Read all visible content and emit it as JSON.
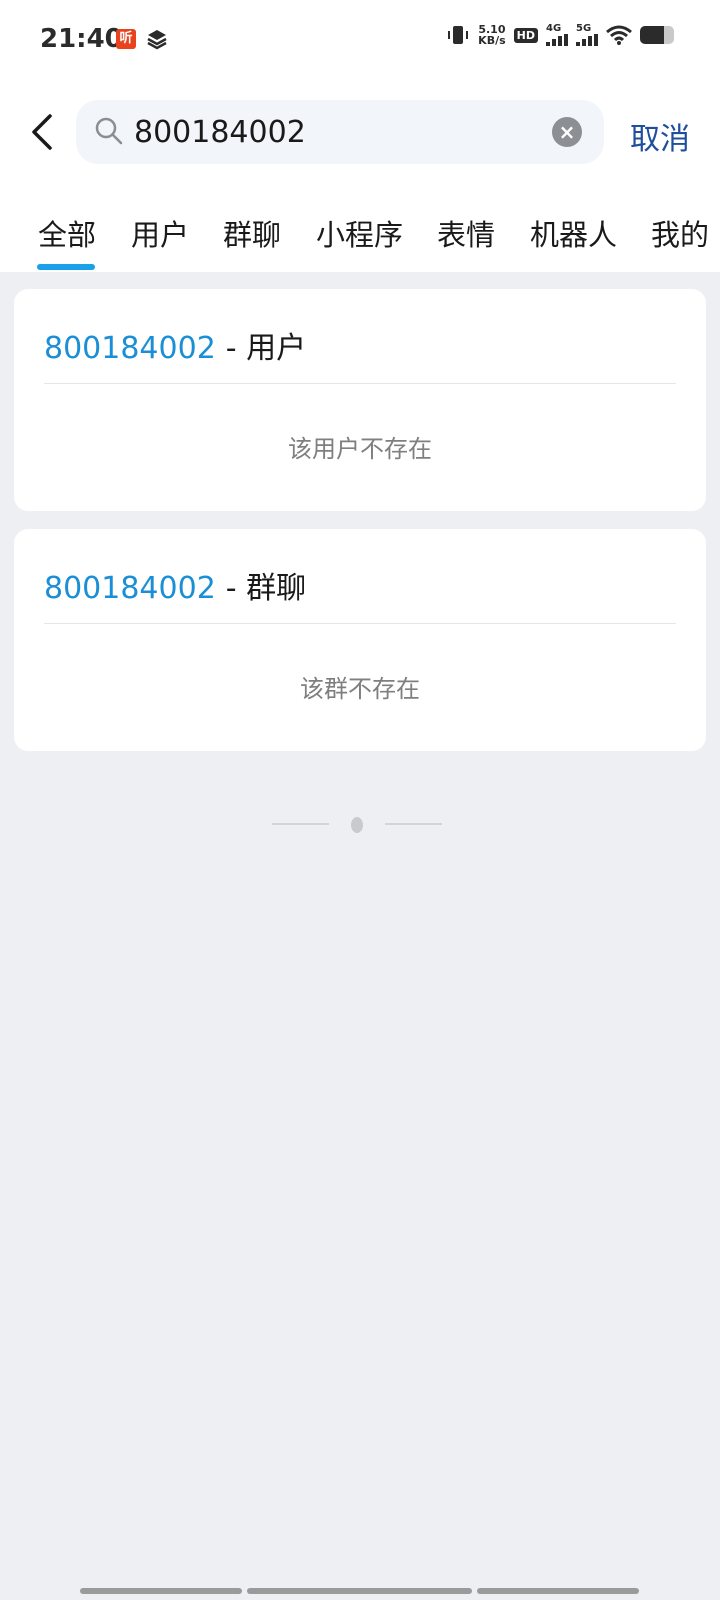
{
  "status_bar": {
    "time": "21:40",
    "ting_label": "听",
    "net_speed_value": "5.10",
    "net_speed_unit": "KB/s",
    "hd_label": "HD",
    "sim1_label": "4G",
    "sim2_label": "5G",
    "battery_level": 0.7
  },
  "search": {
    "query": "800184002",
    "cancel_label": "取消"
  },
  "tabs": [
    {
      "label": "全部",
      "active": true
    },
    {
      "label": "用户",
      "active": false
    },
    {
      "label": "群聊",
      "active": false
    },
    {
      "label": "小程序",
      "active": false
    },
    {
      "label": "表情",
      "active": false
    },
    {
      "label": "机器人",
      "active": false
    },
    {
      "label": "我的",
      "active": false
    }
  ],
  "results": [
    {
      "id": "800184002",
      "type": "- 用户",
      "empty_text": "该用户不存在"
    },
    {
      "id": "800184002",
      "type": "- 群聊",
      "empty_text": "该群不存在"
    }
  ],
  "colors": {
    "accent": "#1aa0e8",
    "link": "#1b8fd6",
    "cancel": "#1f4f9c",
    "background": "#eeeff3"
  }
}
